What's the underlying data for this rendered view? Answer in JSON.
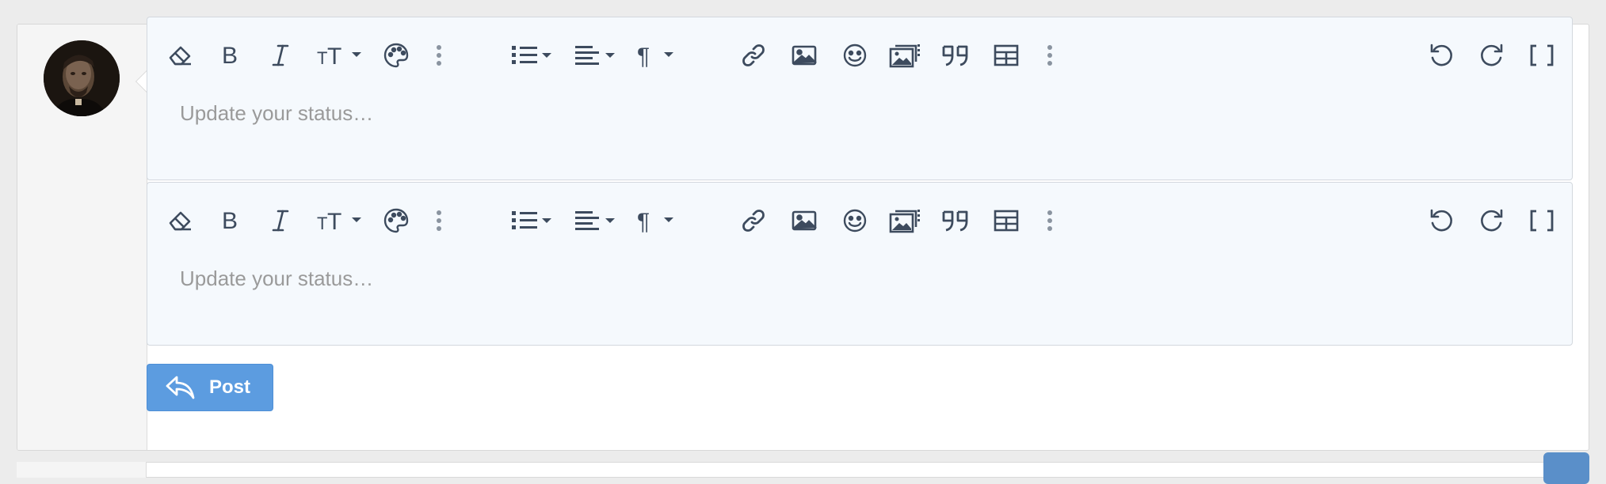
{
  "colors": {
    "accent": "#5c9ce0",
    "icon": "#3d4b5e",
    "editor_bg": "#f5f9fd"
  },
  "user": {
    "avatar_alt": "User avatar"
  },
  "editors": [
    {
      "placeholder": "Update your status…",
      "toolbar": [
        "eraser-icon",
        "bold-icon",
        "italic-icon",
        "text-size-icon",
        "palette-icon",
        "more-vert-icon",
        "list-icon",
        "align-icon",
        "paragraph-icon",
        "link-icon",
        "image-icon",
        "smiley-icon",
        "media-icon",
        "quote-icon",
        "table-icon",
        "more-vert-icon",
        "undo-icon",
        "redo-icon",
        "fullscreen-icon"
      ]
    },
    {
      "placeholder": "Update your status…",
      "toolbar": [
        "eraser-icon",
        "bold-icon",
        "italic-icon",
        "text-size-icon",
        "palette-icon",
        "more-vert-icon",
        "list-icon",
        "align-icon",
        "paragraph-icon",
        "link-icon",
        "image-icon",
        "smiley-icon",
        "media-icon",
        "quote-icon",
        "table-icon",
        "more-vert-icon",
        "undo-icon",
        "redo-icon",
        "fullscreen-icon"
      ]
    }
  ],
  "post": {
    "label": "Post"
  }
}
